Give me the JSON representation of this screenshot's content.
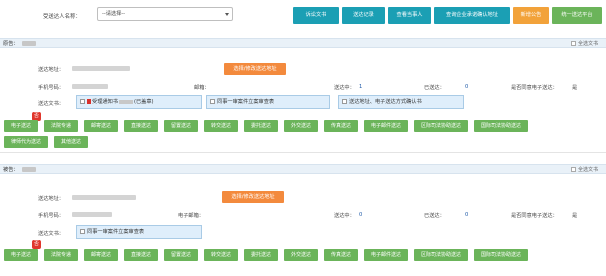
{
  "topbar": {
    "recipient_label": "受送达人名称：",
    "recipient_value": "--请选择--",
    "buttons": [
      {
        "label": "诉讼文书"
      },
      {
        "label": "送达记录"
      },
      {
        "label": "查看当事人"
      },
      {
        "label": "查询企业承诺确认地址"
      },
      {
        "label": "新增公告"
      },
      {
        "label": "统一送达平台"
      }
    ]
  },
  "plaintiff": {
    "party_label": "原告：",
    "select_all": "全选文书",
    "address_label": "送达地址：",
    "modify_button": "选择/修改送达地址",
    "phone_label": "手机号码：",
    "email_label": "邮箱：",
    "sent_label": "送达中：",
    "sent_value": "1",
    "done_label": "已送达：",
    "done_value": "0",
    "agree_label": "是否同意电子送达：",
    "agree_value": "是",
    "docs_label": "送达文书：",
    "docs": [
      {
        "text": "受理通知书"
      },
      {
        "text": "同事一审案件立案审查表"
      },
      {
        "text": "送达地址、电子送达方式确认书"
      }
    ],
    "doc1_suffix": "(已盖章)",
    "e_badge": "否",
    "methods": [
      "电子送达",
      "法院专递",
      "邮寄送达",
      "直接送达",
      "留置送达",
      "转交送达",
      "委托送达",
      "外交送达",
      "传真送达",
      "电子邮件送达",
      "区际司法协助送达",
      "国际司法协助送达"
    ],
    "methods_row2": [
      "律师代为送达",
      "其他送达"
    ]
  },
  "defendant": {
    "party_label": "被告：",
    "select_all": "全选文书",
    "address_label": "送达地址：",
    "modify_button": "选择/修改送达地址",
    "phone_label": "手机号码：",
    "email_label": "电子邮箱：",
    "sent_label": "送达中：",
    "sent_value": "0",
    "done_label": "已送达：",
    "done_value": "0",
    "agree_label": "是否同意电子送达：",
    "agree_value": "是",
    "docs_label": "送达文书：",
    "docs": [
      {
        "text": "同事一审案件立案审查表"
      }
    ],
    "e_badge": "否",
    "methods": [
      "电子送达",
      "法院专递",
      "邮寄送达",
      "直接送达",
      "留置送达",
      "转交送达",
      "委托送达",
      "外交送达",
      "传真送达",
      "电子邮件送达",
      "区际司法协助送达",
      "国际司法协助送达"
    ]
  },
  "colors": {
    "teal": "#1b9fb4",
    "orange": "#f2a23a",
    "green": "#6bb45a",
    "modify": "#f38a3d",
    "badge": "#e0362c"
  }
}
